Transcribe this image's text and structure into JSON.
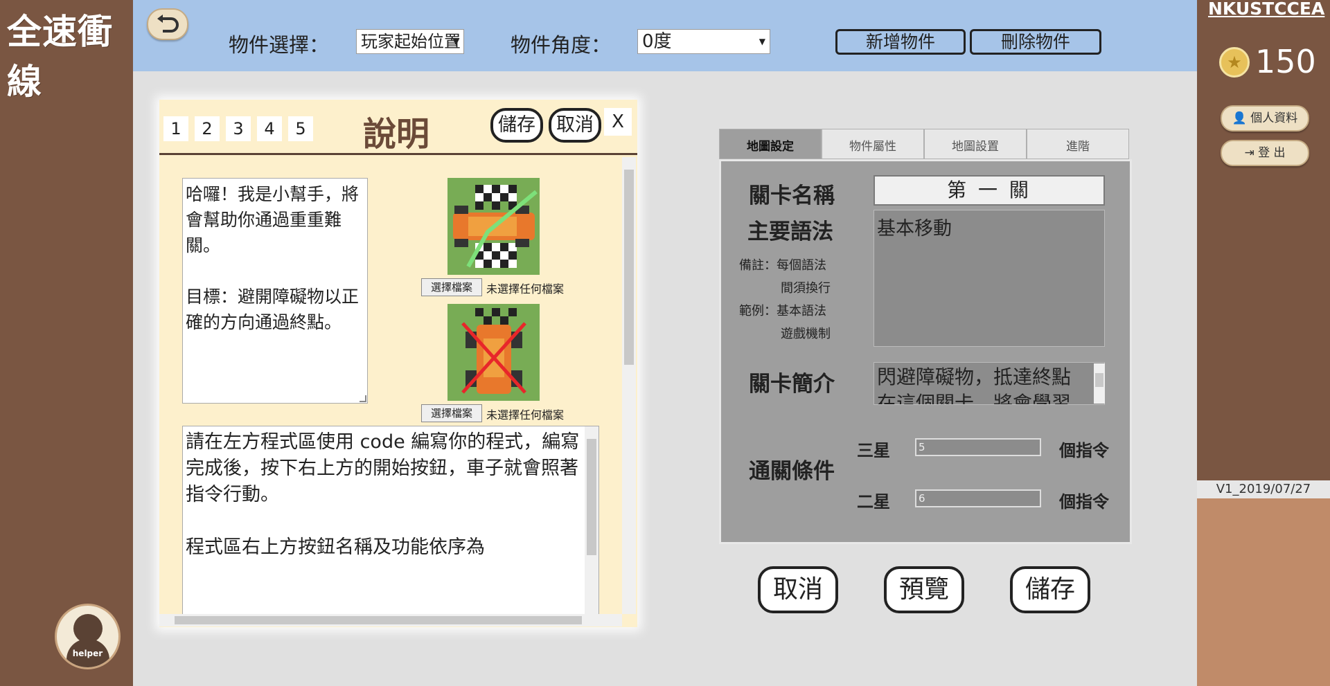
{
  "app": {
    "title": "全速衝線",
    "back_icon": "undo-arrow-icon"
  },
  "toolbar": {
    "object_select_label": "物件選擇：",
    "object_select_value": "玩家起始位置",
    "object_angle_label": "物件角度：",
    "object_angle_value": "0度",
    "add_object_label": "新增物件",
    "delete_object_label": "刪除物件"
  },
  "user": {
    "org_name": "NKUSTCCEA",
    "coins": "150",
    "profile_label": "個人資料",
    "logout_label": "登 出",
    "version": "V1_2019/07/27"
  },
  "helper": {
    "label": "helper"
  },
  "description_panel": {
    "pages": [
      "1",
      "2",
      "3",
      "4",
      "5"
    ],
    "title": "說明",
    "save_label": "儲存",
    "cancel_label": "取消",
    "close_label": "X",
    "intro_text": "哈囉！我是小幫手，將會幫助你通過重重難關。\n\n目標：避開障礙物以正確的方向通過終點。",
    "file_button_label": "選擇檔案",
    "file_status": "未選擇任何檔案",
    "instructions_text": "請在左方程式區使用 code 編寫你的程式，編寫完成後，按下右上方的開始按鈕，車子就會照著指令行動。\n\n程式區右上方按鈕名稱及功能依序為"
  },
  "map_settings": {
    "tabs": [
      "地圖設定",
      "物件屬性",
      "地圖設置",
      "進階"
    ],
    "active_tab": "地圖設定",
    "level_name_label": "關卡名稱",
    "level_name_value": "第 一 關",
    "main_syntax_label": "主要語法",
    "main_syntax_value": "基本移動",
    "note_line1": "備註：每個語法",
    "note_line2": "間須換行",
    "example_line1": "範例：基本語法",
    "example_line2": "遊戲機制",
    "level_intro_label": "關卡簡介",
    "level_intro_value": "閃避障礙物，抵達終點",
    "level_intro_value_2": "在這個關卡，將會學習",
    "clear_condition_label": "通關條件",
    "three_star_label": "三星",
    "three_star_value": "5",
    "two_star_label": "二星",
    "two_star_value": "6",
    "unit_label": "個指令"
  },
  "actions": {
    "cancel_label": "取消",
    "preview_label": "預覽",
    "save_label": "儲存"
  }
}
